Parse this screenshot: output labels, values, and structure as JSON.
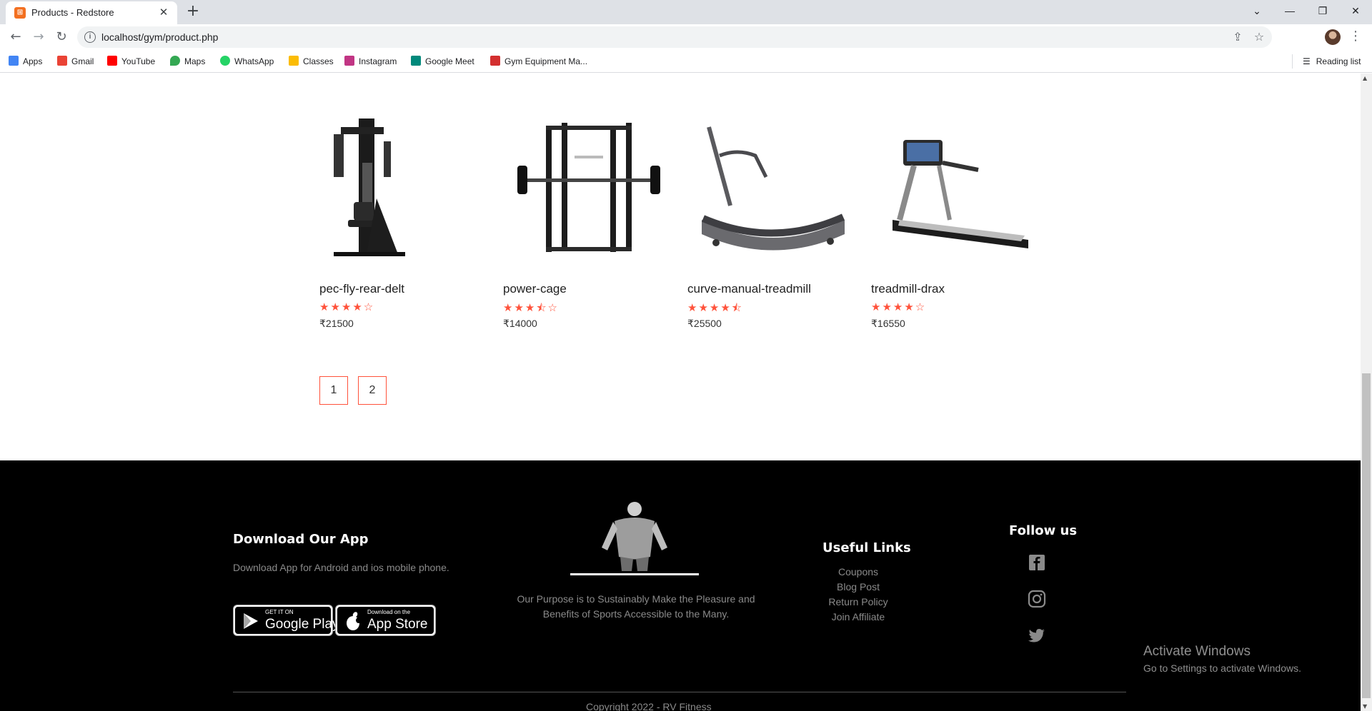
{
  "browser": {
    "tab_title": "Products - Redstore",
    "new_tab": "+",
    "url": "localhost/gym/product.php",
    "bookmarks": [
      {
        "label": "Apps",
        "color": "#4285f4"
      },
      {
        "label": "Gmail",
        "color": "#ea4335"
      },
      {
        "label": "YouTube",
        "color": "#ff0000"
      },
      {
        "label": "Maps",
        "color": "#34a853"
      },
      {
        "label": "WhatsApp",
        "color": "#25d366"
      },
      {
        "label": "Classes",
        "color": "#fbbc04"
      },
      {
        "label": "Instagram",
        "color": "#c13584"
      },
      {
        "label": "Google Meet",
        "color": "#00897b"
      },
      {
        "label": "Gym Equipment Ma...",
        "color": "#d32f2f"
      }
    ],
    "reading_list": "Reading list"
  },
  "products": [
    {
      "name": "pec-fly-rear-delt",
      "rating": 4,
      "stars": "★★★★☆",
      "price": "₹21500",
      "image": "pec-fly-machine"
    },
    {
      "name": "power-cage",
      "rating": 3.5,
      "stars": "★★★⯪☆",
      "price": "₹14000",
      "image": "power-rack"
    },
    {
      "name": "curve-manual-treadmill",
      "rating": 4.5,
      "stars": "★★★★⯪",
      "price": "₹25500",
      "image": "curved-treadmill"
    },
    {
      "name": "treadmill-drax",
      "rating": 4,
      "stars": "★★★★☆",
      "price": "₹16550",
      "image": "treadmill"
    }
  ],
  "pagination": [
    "1",
    "2"
  ],
  "footer": {
    "download_heading": "Download Our App",
    "download_text": "Download App for Android and ios mobile phone.",
    "google_play": {
      "small": "GET IT ON",
      "big": "Google Play"
    },
    "app_store": {
      "small": "Download on the",
      "big": "App Store"
    },
    "purpose_line1": "Our Purpose is to Sustainably Make the Pleasure and",
    "purpose_line2": "Benefits of Sports Accessible to the Many.",
    "useful_heading": "Useful Links",
    "useful_links": [
      "Coupons",
      "Blog Post",
      "Return Policy",
      "Join Affiliate"
    ],
    "follow_heading": "Follow us",
    "social_icons": [
      "facebook-icon",
      "instagram-icon",
      "twitter-icon"
    ],
    "copyright": "Copyright 2022 - RV Fitness"
  },
  "watermark": {
    "title": "Activate Windows",
    "subtitle": "Go to Settings to activate Windows."
  },
  "colors": {
    "accent": "#ff523b",
    "footer_bg": "#000000",
    "footer_text": "#8a8a8a"
  }
}
